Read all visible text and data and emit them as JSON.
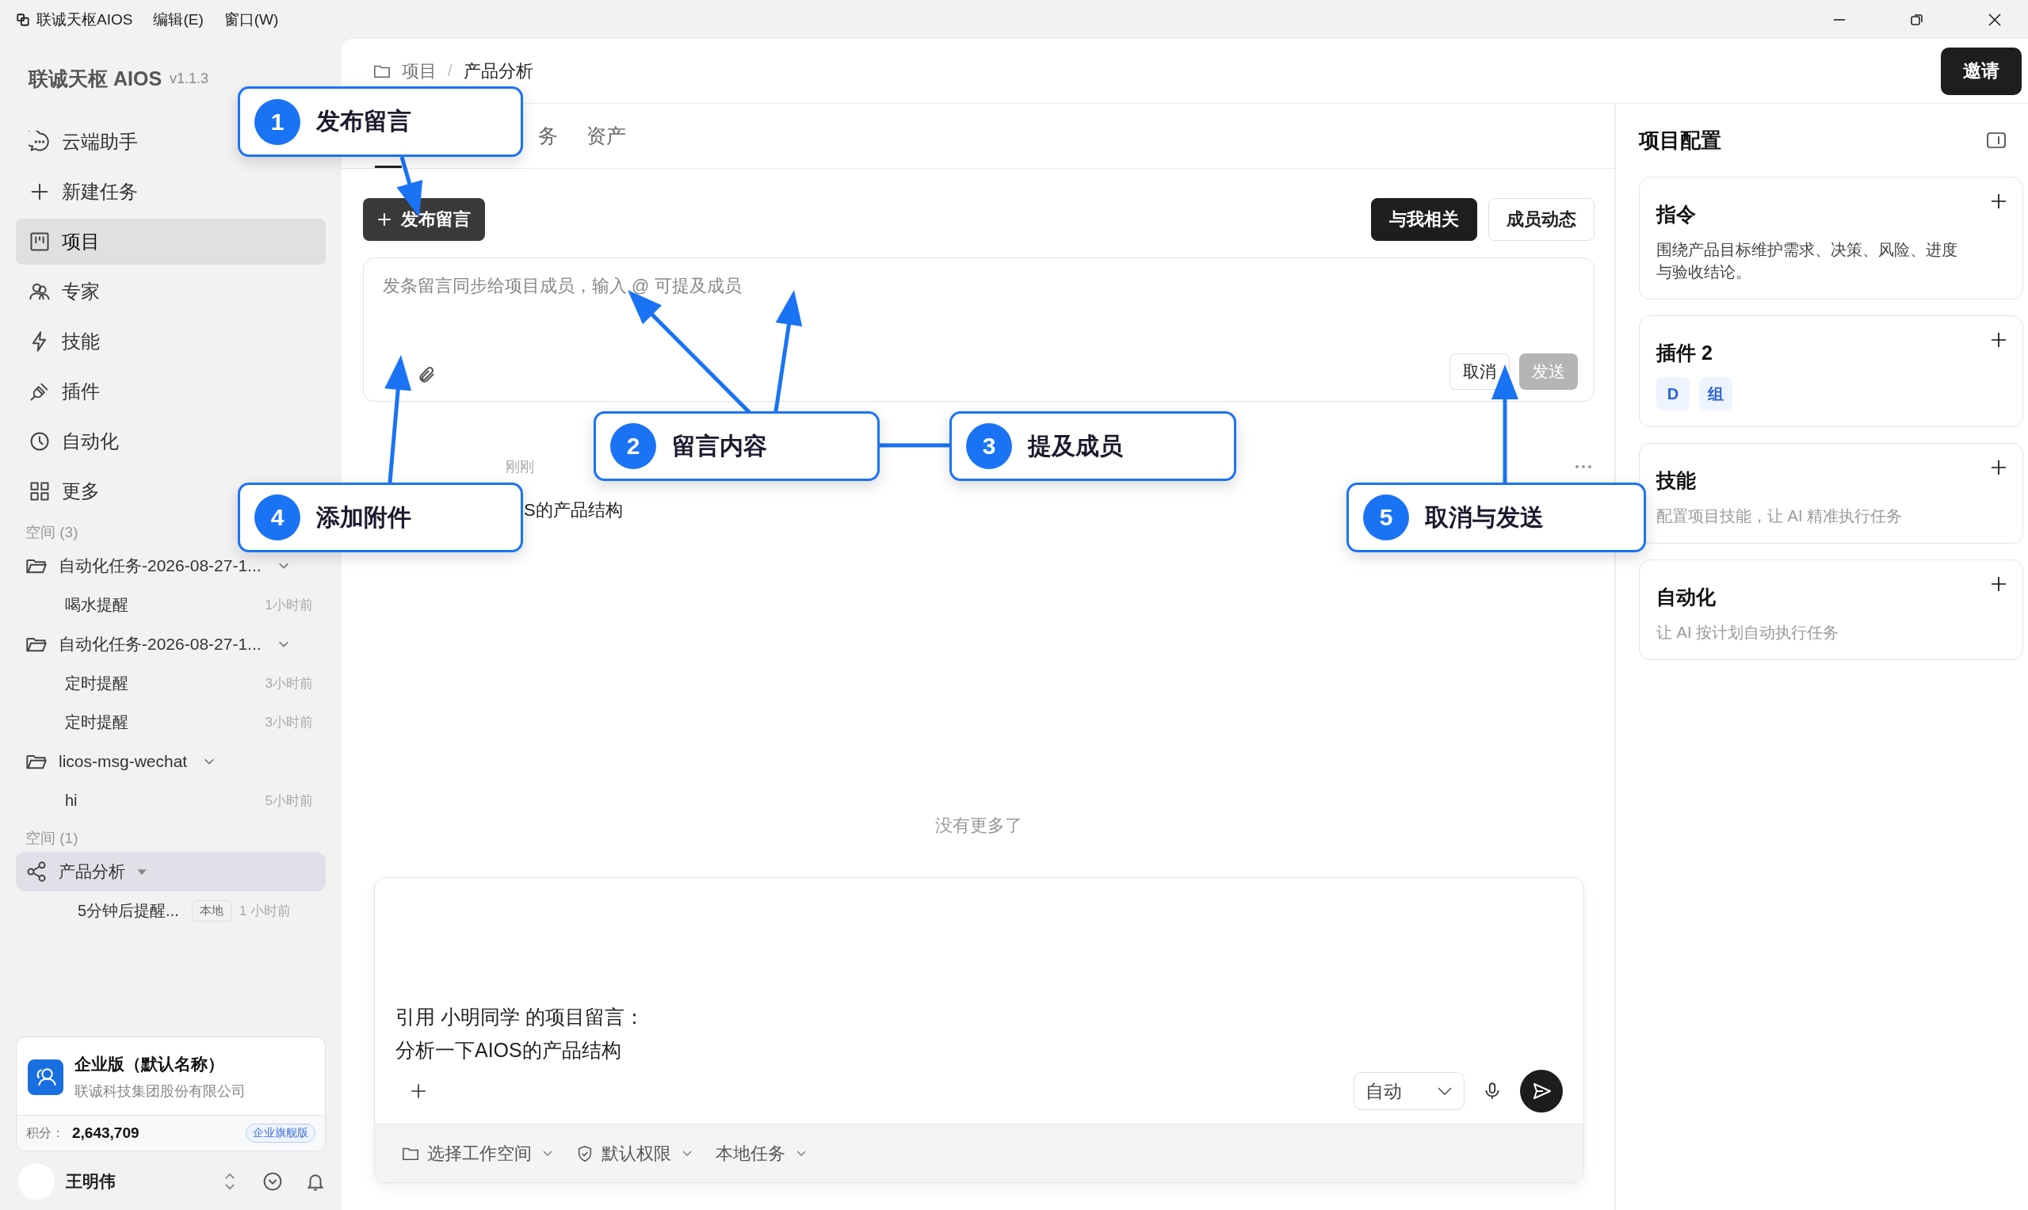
{
  "menu_bar": {
    "app_name": "联诚天枢AIOS",
    "menus": [
      "编辑(E)",
      "窗口(W)"
    ]
  },
  "sidebar": {
    "brand": "联诚天枢 AIOS",
    "version": "v1.1.3",
    "nav": [
      {
        "label": "云端助手",
        "kind": "chat",
        "selected": false
      },
      {
        "label": "新建任务",
        "kind": "plus",
        "selected": false
      },
      {
        "label": "项目",
        "kind": "board",
        "selected": true
      },
      {
        "label": "专家",
        "kind": "people",
        "selected": false
      },
      {
        "label": "技能",
        "kind": "bolt",
        "selected": false
      },
      {
        "label": "插件",
        "kind": "plug",
        "selected": false
      },
      {
        "label": "自动化",
        "kind": "clock",
        "selected": false
      },
      {
        "label": "更多",
        "kind": "grid",
        "selected": false
      }
    ],
    "groups": [
      {
        "label": "空间 (3)",
        "folders": [
          {
            "name": "自动化任务-2026-08-27-1...",
            "kind": "folder",
            "selected": false,
            "children": [
              {
                "name": "喝水提醒",
                "time": "1小时前"
              }
            ]
          },
          {
            "name": "自动化任务-2026-08-27-1...",
            "kind": "folder",
            "selected": false,
            "children": [
              {
                "name": "定时提醒",
                "time": "3小时前"
              },
              {
                "name": "定时提醒",
                "time": "3小时前"
              }
            ]
          },
          {
            "name": "licos-msg-wechat",
            "kind": "folder",
            "selected": false,
            "children": [
              {
                "name": "hi",
                "time": "5小时前"
              }
            ]
          }
        ]
      },
      {
        "label": "空间 (1)",
        "folders": [
          {
            "name": "产品分析",
            "kind": "shared",
            "selected": true,
            "children": [
              {
                "name": "5分钟后提醒...",
                "tag": "本地",
                "time": "1 小时前"
              }
            ]
          }
        ]
      }
    ],
    "plan_card": {
      "title": "企业版（默认名称）",
      "company": "联诚科技集团股份有限公司",
      "points_label": "积分：",
      "points": "2,643,709",
      "badge": "企业旗舰版"
    },
    "user": {
      "name": "王明伟"
    }
  },
  "header": {
    "breadcrumb": [
      "项目",
      "产品分析"
    ],
    "separator": "/",
    "invite": "邀请"
  },
  "tabs": [
    {
      "selected": true
    },
    {
      "label": "务",
      "selected": false
    },
    {
      "label": "资产",
      "selected": false
    }
  ],
  "post_button": "发布留言",
  "filters": [
    {
      "label": "与我相关",
      "selected": true
    },
    {
      "label": "成员动态",
      "selected": false
    }
  ],
  "composer": {
    "placeholder": "发条留言同步给项目成员，输入 @ 可提及成员",
    "cancel": "取消",
    "send": {
      "label": "发送",
      "disabled": true
    }
  },
  "message": {
    "time": "刚刚",
    "text": "S的产品结构"
  },
  "end_note": "没有更多了",
  "chat_input": {
    "lines": [
      "引用 小明同学 的项目留言：",
      "分析一下AIOS的产品结构"
    ],
    "mode": "自动",
    "options": [
      "选择工作空间",
      "默认权限",
      "本地任务"
    ]
  },
  "right_panel": {
    "title": "项目配置",
    "cards": [
      {
        "title": "指令",
        "kind": "content",
        "description": "围绕产品目标维护需求、决策、风险、进度与验收结论。"
      },
      {
        "title": "插件 2",
        "kind": "chips",
        "chips": [
          "D",
          "组"
        ]
      },
      {
        "title": "技能",
        "kind": "hint",
        "description": "配置项目技能，让 AI 精准执行任务"
      },
      {
        "title": "自动化",
        "kind": "hint",
        "description": "让 AI 按计划自动执行任务"
      }
    ]
  },
  "callouts": [
    {
      "number": "1",
      "label": "发布留言"
    },
    {
      "number": "2",
      "label": "留言内容"
    },
    {
      "number": "3",
      "label": "提及成员"
    },
    {
      "number": "4",
      "label": "添加附件"
    },
    {
      "number": "5",
      "label": "取消与发送"
    }
  ]
}
